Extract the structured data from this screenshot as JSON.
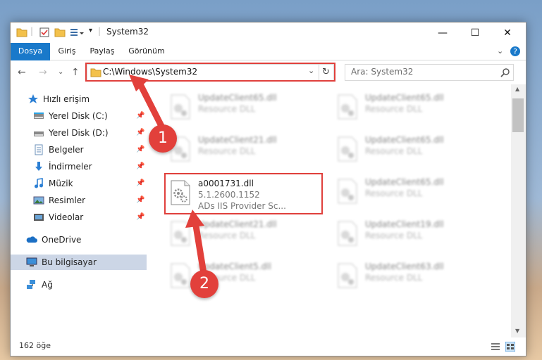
{
  "window": {
    "title": "System32"
  },
  "ribbon": {
    "tabs": [
      "Dosya",
      "Giriş",
      "Paylaş",
      "Görünüm"
    ]
  },
  "address": {
    "path": "C:\\Windows\\System32",
    "search_placeholder": "Ara: System32"
  },
  "sidebar": {
    "items": [
      {
        "label": "Hızlı erişim",
        "icon": "star-icon",
        "pinned": false
      },
      {
        "label": "Yerel Disk (C:)",
        "icon": "drive-icon",
        "pinned": true
      },
      {
        "label": "Yerel Disk (D:)",
        "icon": "drive-icon",
        "pinned": true
      },
      {
        "label": "Belgeler",
        "icon": "documents-icon",
        "pinned": true
      },
      {
        "label": "İndirmeler",
        "icon": "downloads-icon",
        "pinned": true
      },
      {
        "label": "Müzik",
        "icon": "music-icon",
        "pinned": true
      },
      {
        "label": "Resimler",
        "icon": "pictures-icon",
        "pinned": true
      },
      {
        "label": "Videolar",
        "icon": "videos-icon",
        "pinned": true
      },
      {
        "label": "OneDrive",
        "icon": "onedrive-icon",
        "pinned": false
      },
      {
        "label": "Bu bilgisayar",
        "icon": "computer-icon",
        "pinned": false
      },
      {
        "label": "Ağ",
        "icon": "network-icon",
        "pinned": false
      }
    ]
  },
  "files": [
    {
      "name": "UpdateClient65.dll",
      "desc": "Resource DLL"
    },
    {
      "name": "UpdateClient65.dll",
      "desc": "Resource DLL"
    },
    {
      "name": "UpdateClient21.dll",
      "desc": "Resource DLL"
    },
    {
      "name": "UpdateClient65.dll",
      "desc": "Resource DLL"
    },
    {
      "name": "a0001731.dll",
      "version": "5.1.2600.1152",
      "desc": "ADs IIS Provider Sc..."
    },
    {
      "name": "UpdateClient65.dll",
      "desc": "Resource DLL"
    },
    {
      "name": "UpdateClient21.dll",
      "desc": "Resource DLL"
    },
    {
      "name": "UpdateClient19.dll",
      "desc": "Resource DLL"
    },
    {
      "name": "UpdateClient5.dll",
      "desc": "Resource DLL"
    },
    {
      "name": "UpdateClient63.dll",
      "desc": "Resource DLL"
    }
  ],
  "status": {
    "count": "162 öğe"
  },
  "annotations": {
    "step1": "1",
    "step2": "2"
  },
  "colors": {
    "accent": "#1979ca",
    "highlight": "#e0403c"
  }
}
